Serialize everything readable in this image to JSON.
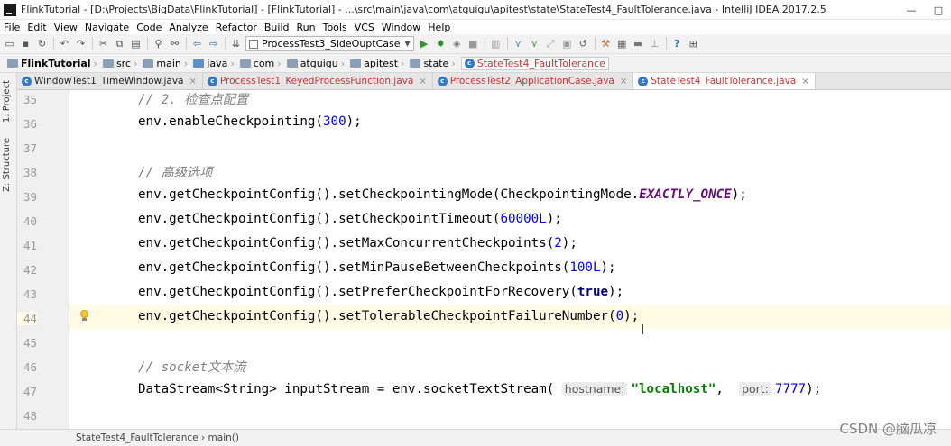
{
  "window": {
    "title": "FlinkTutorial - [D:\\Projects\\BigData\\FlinkTutorial] - [FlinkTutorial] - ...\\src\\main\\java\\com\\atguigu\\apitest\\state\\StateTest4_FaultTolerance.java - IntelliJ IDEA 2017.2.5",
    "minimize": "—",
    "maximize": "□"
  },
  "menu": [
    "File",
    "Edit",
    "View",
    "Navigate",
    "Code",
    "Analyze",
    "Refactor",
    "Build",
    "Run",
    "Tools",
    "VCS",
    "Window",
    "Help"
  ],
  "toolbar": {
    "run_config": "ProcessTest3_SideOuptCase",
    "icons": [
      "open-icon",
      "save-icon",
      "sync-icon",
      "back-icon",
      "forward-icon",
      "cut-icon",
      "copy-icon",
      "paste-icon",
      "find-icon",
      "replace-icon",
      "nav-back-icon",
      "nav-forward-icon",
      "make-icon"
    ]
  },
  "breadcrumb": [
    "FlinkTutorial",
    "src",
    "main",
    "java",
    "com",
    "atguigu",
    "apitest",
    "state",
    "StateTest4_FaultTolerance"
  ],
  "sidebar": {
    "project": "1: Project",
    "structure": "Z: Structure"
  },
  "tabs": [
    {
      "label": "WindowTest1_TimeWindow.java",
      "error": false,
      "active": false
    },
    {
      "label": "ProcessTest1_KeyedProcessFunction.java",
      "error": true,
      "active": false
    },
    {
      "label": "ProcessTest2_ApplicationCase.java",
      "error": true,
      "active": false
    },
    {
      "label": "StateTest4_FaultTolerance.java",
      "error": true,
      "active": true
    }
  ],
  "editor": {
    "lines": [
      {
        "num": "35",
        "text": "// 2. 检查点配置"
      },
      {
        "num": "36",
        "text": "env.enableCheckpointing(300);"
      },
      {
        "num": "37",
        "text": ""
      },
      {
        "num": "38",
        "text": "// 高级选项"
      },
      {
        "num": "39",
        "text": "env.getCheckpointConfig().setCheckpointingMode(CheckpointingMode.EXACTLY_ONCE);"
      },
      {
        "num": "40",
        "text": "env.getCheckpointConfig().setCheckpointTimeout(60000L);"
      },
      {
        "num": "41",
        "text": "env.getCheckpointConfig().setMaxConcurrentCheckpoints(2);"
      },
      {
        "num": "42",
        "text": "env.getCheckpointConfig().setMinPauseBetweenCheckpoints(100L);"
      },
      {
        "num": "43",
        "text": "env.getCheckpointConfig().setPreferCheckpointForRecovery(true);"
      },
      {
        "num": "44",
        "text": "env.getCheckpointConfig().setTolerableCheckpointFailureNumber(0);"
      },
      {
        "num": "45",
        "text": ""
      },
      {
        "num": "46",
        "text": "// socket文本流"
      },
      {
        "num": "47",
        "text": "DataStream<String> inputStream = env.socketTextStream( hostname: \"localhost\",  port: 7777);"
      },
      {
        "num": "48",
        "text": ""
      }
    ],
    "tokens": {
      "l35": "// 2. 检查点配置",
      "l36a": "env.enableCheckpointing(",
      "l36b": "300",
      "l36c": ");",
      "l38": "// 高级选项",
      "l39a": "env.getCheckpointConfig().setCheckpointingMode(CheckpointingMode.",
      "l39b": "EXACTLY_ONCE",
      "l39c": ");",
      "l40a": "env.getCheckpointConfig().setCheckpointTimeout(",
      "l40b": "60000L",
      "l40c": ");",
      "l41a": "env.getCheckpointConfig().setMaxConcurrentCheckpoints(",
      "l41b": "2",
      "l41c": ");",
      "l42a": "env.getCheckpointConfig().setMinPauseBetweenCheckpoints(",
      "l42b": "100L",
      "l42c": ");",
      "l43a": "env.getCheckpointConfig().setPreferCheckpointForRecovery(",
      "l43b": "true",
      "l43c": ");",
      "l44a": "env.getCheckpointConfig().setTolerableCheckpointFailureNumber(",
      "l44b": "0",
      "l44c": ");",
      "l46": "// socket文本流",
      "l47a": "DataStream<String> inputStream = env.socketTextStream(",
      "l47hint1": "hostname:",
      "l47str": "\"localhost\"",
      "l47comma": ", ",
      "l47hint2": "port:",
      "l47num": "7777",
      "l47end": ");"
    }
  },
  "status": {
    "path": "StateTest4_FaultTolerance  ›  main()"
  },
  "watermark": "CSDN @脑瓜凉",
  "colors": {
    "keyword": "#000080",
    "number": "#0000ff",
    "string": "#008000",
    "comment": "#808080",
    "static_field": "#660e7a",
    "current_line": "#fffae3"
  }
}
